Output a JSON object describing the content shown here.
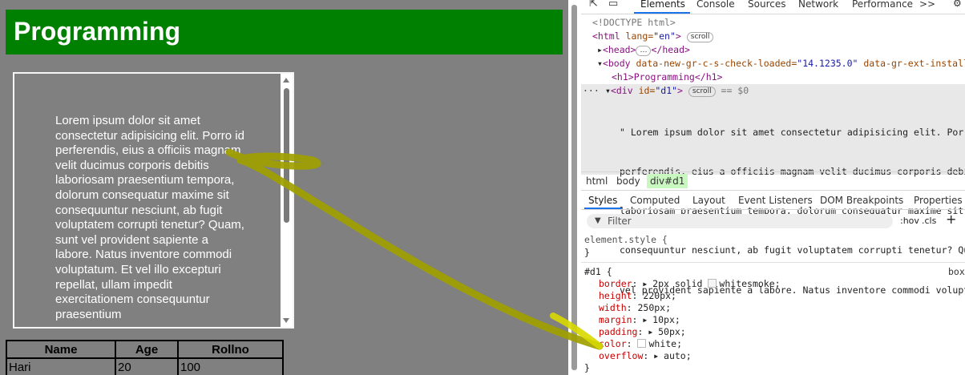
{
  "page": {
    "heading": "Programming",
    "div_text": "Lorem ipsum dolor sit amet consectetur adipisicing elit. Porro id perferendis, eius a officiis magnam velit ducimus corporis debitis laboriosam praesentium tempora, dolorum consequatur maxime sit consequuntur nesciunt, ab fugit voluptatem corrupti tenetur? Quam, sunt vel provident sapiente a labore. Natus inventore commodi voluptatum. Et vel illo excepturi repellat, ullam impedit exercitationem consequuntur praesentium",
    "table": {
      "headers": [
        "Name",
        "Age",
        "Rollno"
      ],
      "rows": [
        [
          "Hari",
          "20",
          "100"
        ]
      ]
    }
  },
  "devtools": {
    "top_tabs": [
      "Elements",
      "Console",
      "Sources",
      "Network",
      "Performance"
    ],
    "more_tabs": ">>",
    "dom": {
      "doctype": "<!DOCTYPE html>",
      "html_open": "<html",
      "html_attr": " lang=",
      "html_attr_val": "\"en\"",
      "html_close": ">",
      "scroll_badge": "scroll",
      "head_open": "<head>",
      "head_ellipsis": "…",
      "head_close": "</head>",
      "body_open": "<body",
      "body_attr1": " data-new-gr-c-s-check-loaded=",
      "body_attr1_val": "\"14.1235.0\"",
      "body_attr2": " data-gr-ext-installed",
      "h1_line": "<h1>Programming</h1>",
      "div_open": "<div",
      "div_attr": " id=",
      "div_attr_val": "\"d1\"",
      "div_close": ">",
      "eq0": "== $0",
      "ellipsis_dots": "···",
      "text_lines": [
        "\" Lorem ipsum dolor sit amet consectetur adipisicing elit. Porro",
        "perferendis, eius a officiis magnam velit ducimus corporis debiti",
        "laboriosam praesentium tempora, dolorum consequatur maxime sit",
        "consequuntur nesciunt, ab fugit voluptatem corrupti tenetur? Quam",
        "vel provident sapiente a labore. Natus inventore commodi voluptat"
      ]
    },
    "breadcrumbs": [
      "html",
      "body",
      "div#d1"
    ],
    "sub_tabs": [
      "Styles",
      "Computed",
      "Layout",
      "Event Listeners",
      "DOM Breakpoints",
      "Properties"
    ],
    "filter_placeholder": "Filter",
    "filter_icon": "▼",
    "hov": ":hov",
    "cls": ".cls",
    "plus": "+",
    "styles": {
      "element_style_open": "element.style {",
      "close_brace": "}",
      "selector": "#d1 {",
      "source": "box",
      "rules": [
        {
          "prop": "border",
          "arrow": true,
          "value": "2px solid",
          "swatch": "#f5f5f5",
          "value2": "whitesmoke;"
        },
        {
          "prop": "height",
          "arrow": false,
          "value": "220px;"
        },
        {
          "prop": "width",
          "arrow": false,
          "value": "250px;"
        },
        {
          "prop": "margin",
          "arrow": true,
          "value": "10px;"
        },
        {
          "prop": "padding",
          "arrow": true,
          "value": "50px;"
        },
        {
          "prop": "color",
          "arrow": false,
          "swatch": "#ffffff",
          "value": "white;"
        },
        {
          "prop": "overflow",
          "arrow": true,
          "value": "auto;"
        }
      ]
    }
  },
  "colors": {
    "page_bg": "#808080",
    "heading_bg": "#008000",
    "annotation_arrow": "#a0a000"
  }
}
